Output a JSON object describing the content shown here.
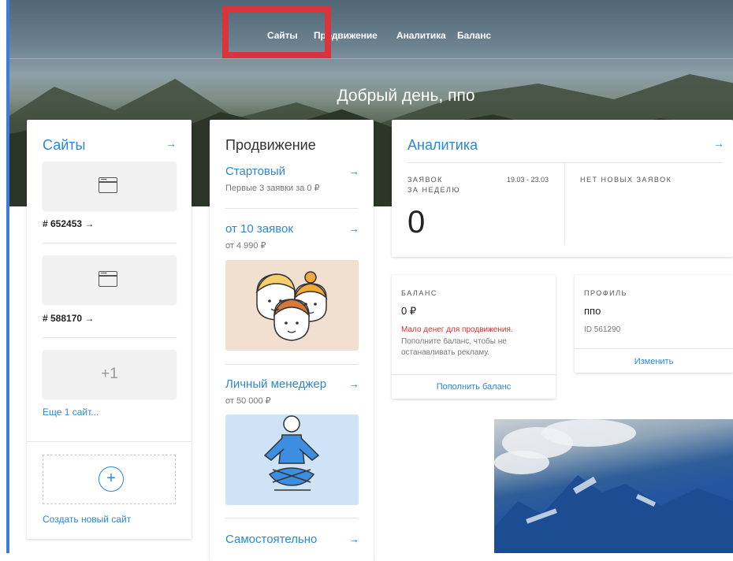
{
  "nav": {
    "items": [
      "Сайты",
      "Продвижение",
      "Аналитика",
      "Баланс"
    ]
  },
  "greeting": "Добрый день, ппо",
  "sites": {
    "title": "Сайты",
    "arrow": "→",
    "items": [
      {
        "id": "# 652453 →"
      },
      {
        "id": "# 588170 →"
      }
    ],
    "more_count": "+1",
    "more_link": "Еще 1 сайт...",
    "create_link": "Создать новый сайт",
    "create_icon": "+"
  },
  "promotion": {
    "title": "Продвижение",
    "arrow": "→",
    "items": [
      {
        "title": "Стартовый",
        "sub": "Первые 3 заявки за 0 ₽"
      },
      {
        "title": "от 10 заявок",
        "sub": "от 4 990 ₽"
      },
      {
        "title": "Личный менеджер",
        "sub": "от 50 000 ₽"
      },
      {
        "title": "Самостоятельно",
        "sub": ""
      }
    ]
  },
  "analytics": {
    "title": "Аналитика",
    "arrow": "→",
    "requests_label_line1": "ЗАЯВОК",
    "requests_label_line2": "ЗА НЕДЕЛЮ",
    "date_range": "19.03 - 23.03",
    "count": "0",
    "no_new": "НЕТ НОВЫХ ЗАЯВОК"
  },
  "balance": {
    "label": "БАЛАНС",
    "value": "0 ₽",
    "warning": "Мало денег для продвижения.",
    "note": "Пополните баланс, чтобы не останавливать рекламу.",
    "action": "Пополнить баланс"
  },
  "profile": {
    "label": "ПРОФИЛЬ",
    "name": "ппо",
    "id": "ID 561290",
    "action": "Изменить"
  },
  "colors": {
    "accent": "#2d86d2",
    "highlight": "#d9343b",
    "warning": "#c0392b"
  }
}
